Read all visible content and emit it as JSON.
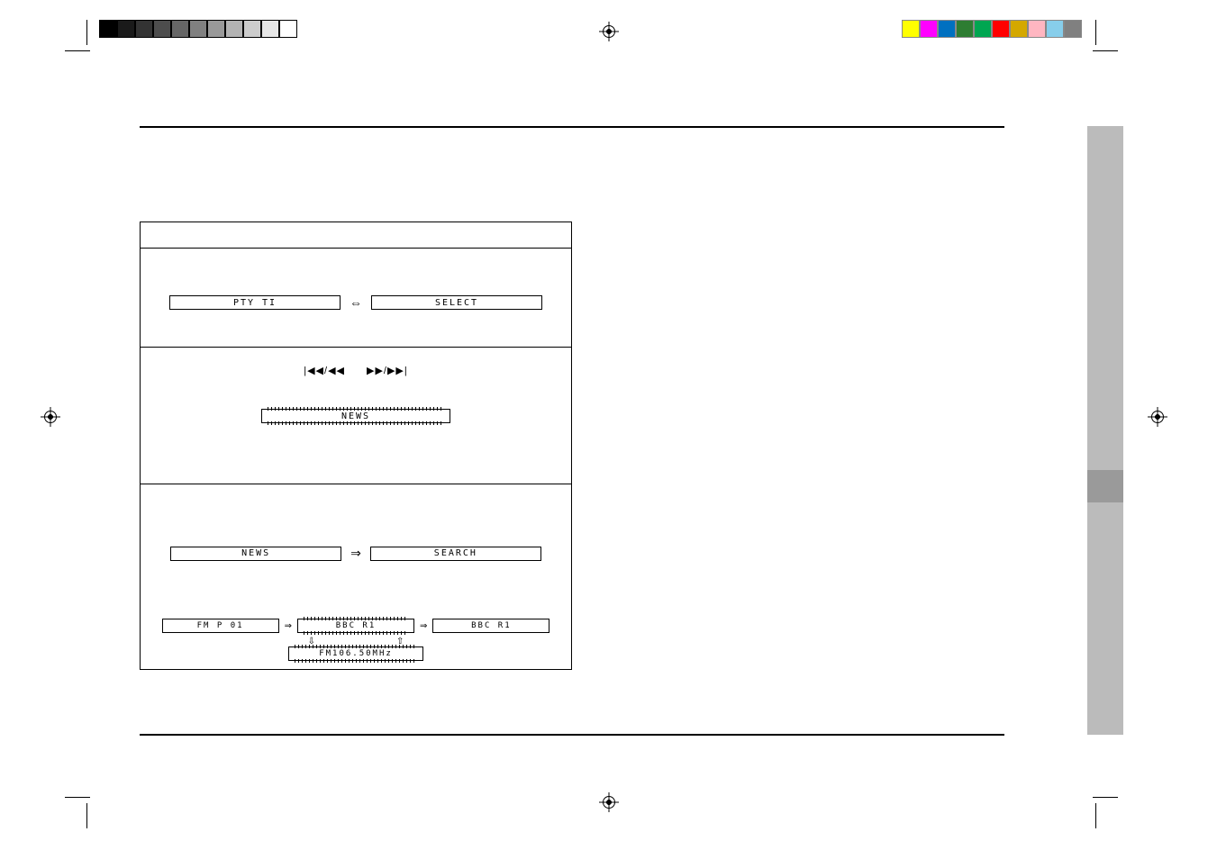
{
  "calibration": {
    "grays": [
      "#000",
      "#1a1a1a",
      "#333",
      "#4d4d4d",
      "#666",
      "#808080",
      "#999",
      "#b3b3b3",
      "#ccc",
      "#e6e6e6",
      "#fff"
    ],
    "colors": [
      "#ffff00",
      "#ff00ff",
      "#0070c0",
      "#00a651",
      "#00a651",
      "#ff0000",
      "#d4a800",
      "#ffb6c1",
      "#87ceeb",
      "#808080"
    ]
  },
  "step1": {
    "display_left": "PTY  TI",
    "arrow": "⇔",
    "display_right": "SELECT"
  },
  "step2": {
    "buttons_prev": "|◀◀/◀◀",
    "buttons_next": "▶▶/▶▶|",
    "display": "NEWS"
  },
  "step3": {
    "display_left": "NEWS",
    "arrow": "⇒",
    "display_right": "SEARCH"
  },
  "step4": {
    "d1": "FM    P 01",
    "a1": "⇒",
    "d2": "BBC  R1",
    "a2": "⇒",
    "d3": "BBC  R1",
    "down": "⇩",
    "up": "⇧",
    "d4": "FM106.50MHz"
  }
}
